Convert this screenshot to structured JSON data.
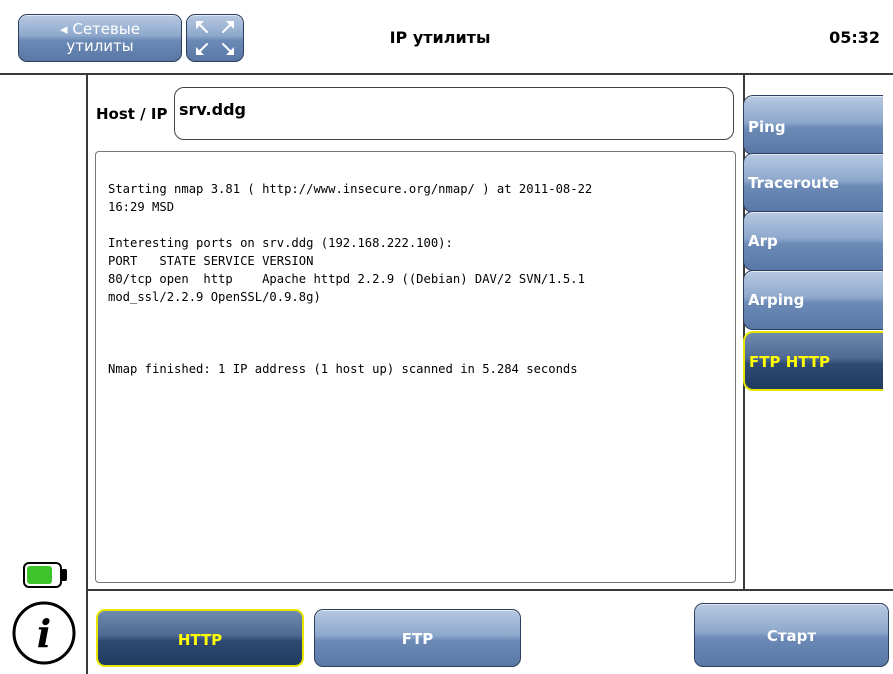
{
  "header": {
    "back_arrow": "◂",
    "back_label_line1": "Сетевые",
    "back_label_line2": "утилиты",
    "title": "IP утилиты",
    "clock": "05:32"
  },
  "host": {
    "label": "Host / IP",
    "value": "srv.ddg"
  },
  "output": {
    "lines": [
      "Starting nmap 3.81 ( http://www.insecure.org/nmap/ ) at 2011-08-22",
      "16:29 MSD",
      "",
      "Interesting ports on srv.ddg (192.168.222.100):",
      "PORT   STATE SERVICE VERSION",
      "80/tcp open  http    Apache httpd 2.2.9 ((Debian) DAV/2 SVN/1.5.1",
      "mod_ssl/2.2.9 OpenSSL/0.9.8g)",
      "",
      "",
      "",
      "Nmap finished: 1 IP address (1 host up) scanned in 5.284 seconds"
    ]
  },
  "side_tabs": [
    {
      "label": "Ping"
    },
    {
      "label": "Traceroute"
    },
    {
      "label": "Arp"
    },
    {
      "label": "Arping"
    },
    {
      "label": "FTP HTTP",
      "active": true
    }
  ],
  "bottom": {
    "http_label": "HTTP",
    "ftp_label": "FTP",
    "start_label": "Старт"
  },
  "status": {
    "battery_level": 0.8,
    "battery_color": "#3ec42b",
    "info_icon": "info-icon"
  },
  "colors": {
    "button_light": "#8ea8cc",
    "button_active": "#2f4a72",
    "active_text": "#ffff00"
  }
}
